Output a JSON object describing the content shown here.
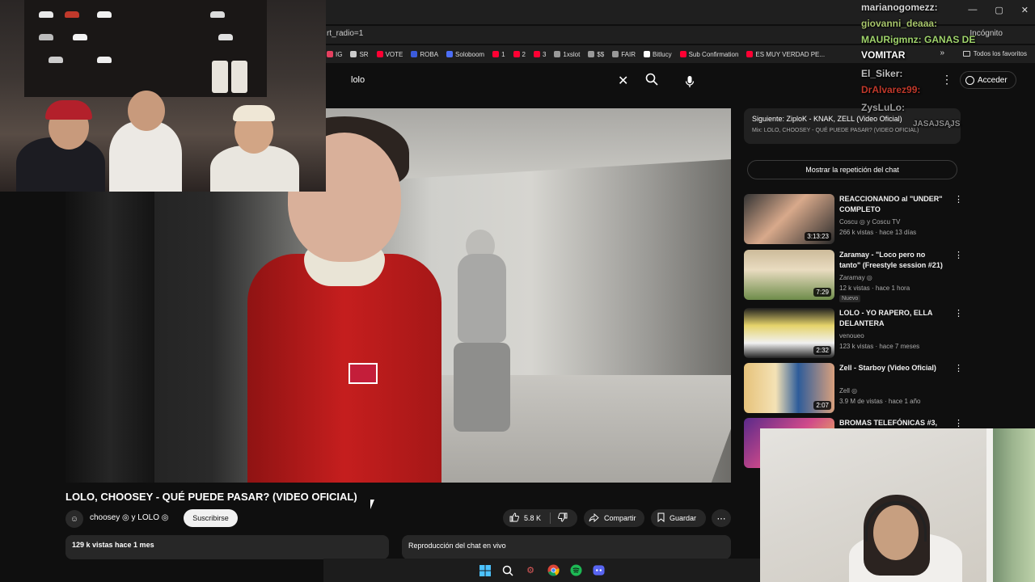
{
  "browser": {
    "address": "rt_radio=1",
    "incognito_label": "Incógnito",
    "window_controls": [
      "—",
      "▢",
      "✕"
    ],
    "bookmarks": [
      {
        "label": "IG",
        "color": "#e4405f"
      },
      {
        "label": "SR",
        "color": "#cccccc"
      },
      {
        "label": "VOTE",
        "color": "#ff0033"
      },
      {
        "label": "ROBA",
        "color": "#3b5bdb"
      },
      {
        "label": "Soloboom",
        "color": "#4c6ef5"
      },
      {
        "label": "1",
        "color": "#ff0033"
      },
      {
        "label": "2",
        "color": "#ff0033"
      },
      {
        "label": "3",
        "color": "#ff0033"
      },
      {
        "label": "1xslot",
        "color": "#999999"
      },
      {
        "label": "$$",
        "color": "#999999"
      },
      {
        "label": "FAIR",
        "color": "#999999"
      },
      {
        "label": "Bitlucy",
        "color": "#ffffff"
      },
      {
        "label": "Sub Confirmation",
        "color": "#ff0033"
      },
      {
        "label": "ES MUY VERDAD PE...",
        "color": "#ff0033"
      }
    ],
    "bookmarks_more": "»",
    "favorites_label": "Todos los favoritos"
  },
  "youtube": {
    "search_value": "lolo",
    "signin_label": "Acceder",
    "video": {
      "title": "LOLO, CHOOSEY - QUÉ PUEDE PASAR? (VIDEO OFICIAL)",
      "channel": "choosey ◎ y LOLO ◎",
      "subscribe_label": "Suscribirse",
      "likes": "5.8 K",
      "share_label": "Compartir",
      "save_label": "Guardar",
      "stats": "129 k vistas  hace 1 mes",
      "chat_replay": "Reproducción del chat en vivo"
    },
    "up_next": {
      "title": "Siguiente: ZiploK - KNAK, ZELL (Video Oficial)",
      "subtitle": "Mix: LOLO, CHOOSEY - QUÉ PUEDE PASAR? (VIDEO OFICIAL)"
    },
    "show_chat_label": "Mostrar la repetición del chat",
    "recommendations": [
      {
        "title": "REACCIONANDO al \"UNDER\" COMPLETO",
        "channel": "Coscu ◎ y Coscu TV",
        "meta": "266 k vistas · hace 13 días",
        "duration": "3:13:23",
        "badge": ""
      },
      {
        "title": "Zaramay - \"Loco pero no tanto\" (Freestyle session #21)",
        "channel": "Zaramay ◎",
        "meta": "12 k vistas · hace 1 hora",
        "duration": "7:29",
        "badge": "Nuevo"
      },
      {
        "title": "LOLO - YO RAPERO, ELLA DELANTERA",
        "channel": "venoueo",
        "meta": "123 k vistas · hace 7 meses",
        "duration": "2:32",
        "badge": ""
      },
      {
        "title": "Zell - Starboy (Video Oficial)",
        "channel": "Zell ◎",
        "meta": "3.9 M de vistas · hace 1 año",
        "duration": "2:07",
        "badge": ""
      },
      {
        "title": "BROMAS TELEFÓNICAS #3,",
        "channel": "",
        "meta": "",
        "duration": "",
        "badge": ""
      }
    ]
  },
  "stream_chat": [
    {
      "text": "marianogomezz:",
      "color": "#d7d7d7"
    },
    {
      "text": "giovanni_deaaa:",
      "color": "#a8c66c"
    },
    {
      "text": "MAURigmnz: GANAS DE",
      "color": "#9fd36b"
    },
    {
      "text": "VOMITAR",
      "color": "#ffffff"
    },
    {
      "text": "El_Siker:",
      "color": "#bfbfbf"
    },
    {
      "text": "DrAlvarez99:",
      "color": "#c0392b"
    },
    {
      "text": "ZysLuLo:",
      "color": "#9e9e9e"
    },
    {
      "text": "JASAJSAJS",
      "color": "#8e8e8e"
    }
  ]
}
